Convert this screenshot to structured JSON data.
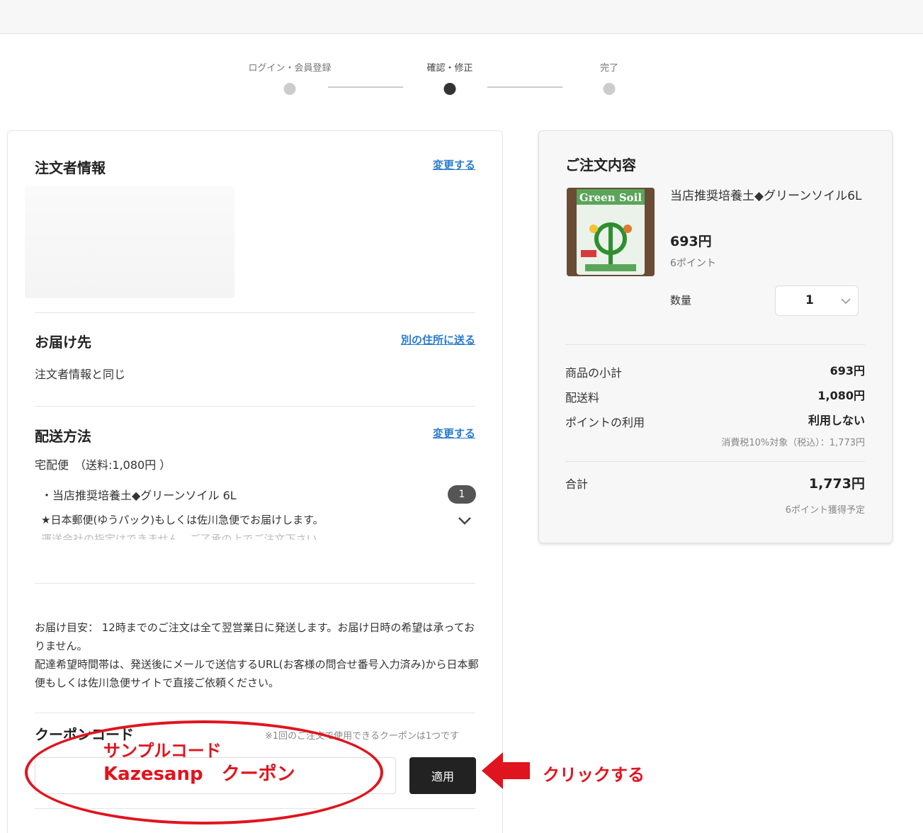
{
  "stepper": {
    "steps": [
      {
        "label": "ログイン・会員登録"
      },
      {
        "label": "確認・修正"
      },
      {
        "label": "完了"
      }
    ]
  },
  "orderer": {
    "title": "注文者情報",
    "change_link": "変更する"
  },
  "delivery": {
    "title": "お届け先",
    "other_address_link": "別の住所に送る",
    "value": "注文者情報と同じ"
  },
  "shipping": {
    "title": "配送方法",
    "change_link": "変更する",
    "method": "宅配便　（送料:1,080円 ）",
    "item": "・当店推奨培養土◆グリーンソイル 6L",
    "item_qty": "1",
    "notice": "★日本郵便(ゆうパック)もしくは佐川急便でお届けします。",
    "notice_cont": "運送会社の指定はできません。ご了承の上でご注文下さい。"
  },
  "estimate_note": {
    "line1": "お届け目安： 12時までのご注文は全て翌営業日に発送します。お届け日時の希望は承っておりません。",
    "line2": "配達希望時間帯は、発送後にメールで送信するURL(お客様の問合せ番号入力済み)から日本郵便もしくは佐川急便サイトで直接ご依頼ください。"
  },
  "coupon": {
    "title": "クーポンコード",
    "note": "※1回のご注文で使用できるクーポンは1つです",
    "input_value": "",
    "apply_label": "適用"
  },
  "annotation": {
    "sample_label": "サンプルコード",
    "sample_code": "Kazesanp　クーポン",
    "click_label": "クリックする",
    "color": "#e0141e"
  },
  "order_summary": {
    "title": "ご注文内容",
    "product": {
      "name": "当店推奨培養土◆グリーンソイル6L",
      "price": "693円",
      "points": "6ポイント",
      "image_text": "Green Soil"
    },
    "qty_label": "数量",
    "qty_value": "1",
    "rows": [
      {
        "label": "商品の小計",
        "value": "693円"
      },
      {
        "label": "配送料",
        "value": "1,080円"
      },
      {
        "label": "ポイントの利用",
        "value": "利用しない"
      }
    ],
    "tax_note": "消費税10%対象（税込）：1,773円",
    "total_label": "合計",
    "total_value": "1,773円",
    "points_earned": "6ポイント獲得予定"
  }
}
